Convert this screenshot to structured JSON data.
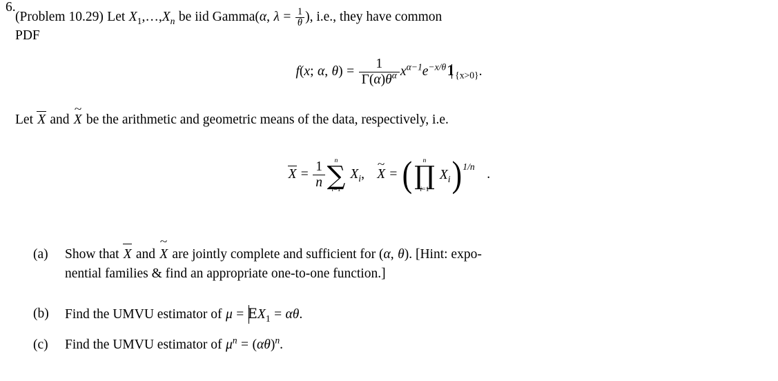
{
  "document": {
    "type": "latex-problem-set",
    "problem": {
      "number": "6.",
      "source_label": "(Problem 10.29)",
      "line1": {
        "text_before": "(Problem 10.29) Let",
        "rv_list": "X",
        "rv_sub1": "1",
        "dots": ",…,",
        "rv_last": "X",
        "rv_last_sub": "n",
        "text_mid": "be iid Gamma(",
        "alpha": "α",
        "comma": ",",
        "lambda": "λ",
        "equals": "=",
        "frac_num": "1",
        "frac_den": "θ",
        "text_after": "), i.e., they have common"
      },
      "line2": "PDF"
    },
    "equation_pdf": {
      "lhs": "f(x; α, θ)",
      "f": "f",
      "open": "(",
      "x": "x",
      "semicolon": ";",
      "alpha": "α",
      "comma": ",",
      "theta": "θ",
      "close": ")",
      "equals": "=",
      "frac_num": "1",
      "frac_den_gamma": "Γ",
      "frac_den_open": "(",
      "frac_den_alpha": "α",
      "frac_den_close": ")",
      "frac_den_theta": "θ",
      "frac_den_theta_pow": "α",
      "x_base": "x",
      "x_pow": "α−1",
      "e_base": "e",
      "e_pow": "−x/θ",
      "indicator": "1",
      "indicator_sub": "{x>0}",
      "period": "."
    },
    "paragraph_let": {
      "text_1": "Let",
      "xbar": "X",
      "text_2": "and",
      "xtilde": "X",
      "text_3": "be the arithmetic and geometric means of the data, respectively, i.e."
    },
    "equation_means": {
      "xbar": "X",
      "equals1": "=",
      "frac_num": "1",
      "frac_den": "n",
      "sum_glyph": "∑",
      "sum_top": "n",
      "sum_bot_i": "i",
      "sum_bot_eq": "=",
      "sum_bot_1": "1",
      "summand": "X",
      "summand_sub": "i",
      "comma": ",",
      "xtilde": "X",
      "equals2": "=",
      "paren_open": "(",
      "prod_glyph": "∏",
      "prod_top": "n",
      "prod_bot_i": "i",
      "prod_bot_eq": "=",
      "prod_bot_1": "1",
      "factor": "X",
      "factor_sub": "i",
      "paren_close": ")",
      "power": "1/n",
      "period": "."
    },
    "subitems": [
      {
        "label": "(a)",
        "line1_a": "Show that",
        "xbar": "X",
        "line1_b": "and",
        "xtilde": "X",
        "line1_c": "are jointly complete and sufficient for (",
        "alpha": "α",
        "comma": ",",
        "theta": "θ",
        "line1_d": "). [Hint: expo-",
        "line2": "nential families & find an appropriate one-to-one function.]"
      },
      {
        "label": "(b)",
        "text_1": "Find the UMVU estimator of",
        "mu": "μ",
        "equals1": "=",
        "blackboard_E": "E",
        "X": "X",
        "X_sub": "1",
        "equals2": "=",
        "alpha": "α",
        "theta": "θ",
        "period": "."
      },
      {
        "label": "(c)",
        "text_1": "Find the UMVU estimator of",
        "mu": "μ",
        "mu_pow": "n",
        "equals1": "=",
        "paren_open": "(",
        "alpha": "α",
        "theta": "θ",
        "paren_close": ")",
        "pow": "n",
        "period": "."
      }
    ],
    "colors": {
      "text": "#000000",
      "background": "#ffffff"
    }
  }
}
